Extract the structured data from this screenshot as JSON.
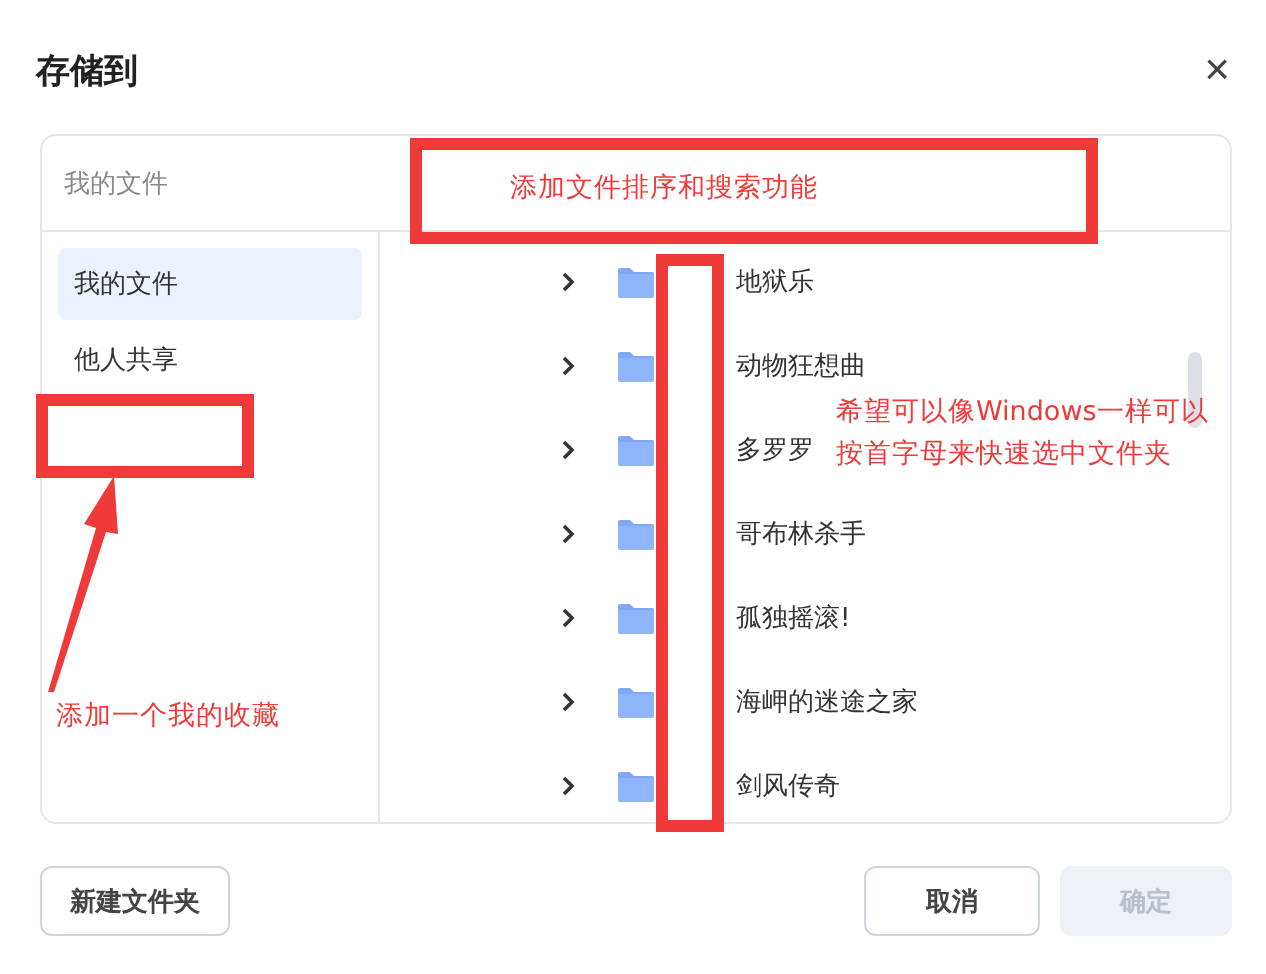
{
  "dialog": {
    "title": "存储到",
    "close": "×"
  },
  "breadcrumb": "我的文件",
  "sidebar": {
    "items": [
      {
        "label": "我的文件",
        "selected": true
      },
      {
        "label": "他人共享",
        "selected": false
      }
    ]
  },
  "folders": [
    {
      "name": "地狱乐"
    },
    {
      "name": "动物狂想曲"
    },
    {
      "name": "多罗罗"
    },
    {
      "name": "哥布林杀手"
    },
    {
      "name": "孤独摇滚!"
    },
    {
      "name": "海岬的迷途之家"
    },
    {
      "name": "剑风传奇"
    }
  ],
  "buttons": {
    "new_folder": "新建文件夹",
    "cancel": "取消",
    "confirm": {
      "label": "确定",
      "disabled": true
    }
  },
  "annotations": {
    "sort_search_note": "添加文件排序和搜索功能",
    "favorites_note": "添加一个我的收藏",
    "quick_select_note": "希望可以像Windows一样可以按首字母来快速选中文件夹"
  }
}
